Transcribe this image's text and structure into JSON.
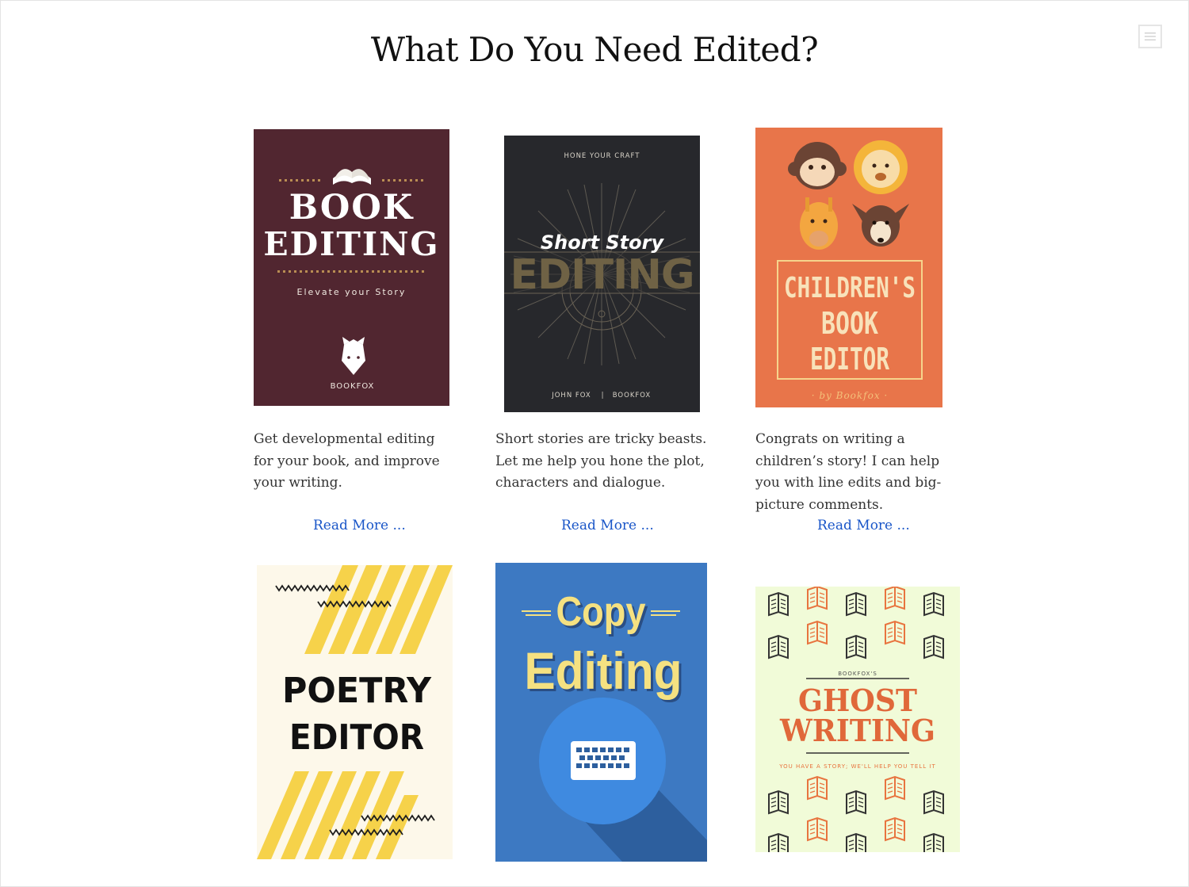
{
  "page": {
    "title": "What Do You Need Edited?"
  },
  "menu": {
    "icon": "hamburger-menu-icon"
  },
  "colors": {
    "link": "#1a56c8",
    "book_editing_bg": "#512630",
    "short_story_bg": "#27282c",
    "childrens_bg": "#e8754a",
    "poetry_bg": "#fdf8ea",
    "copy_bg": "#3d79c2",
    "ghost_bg": "#f1fbd8"
  },
  "services": [
    {
      "cover": {
        "title_line1": "BOOK",
        "title_line2": "EDITING",
        "subtitle": "Elevate your Story",
        "publisher": "BOOKFOX",
        "icons": [
          "open-book-icon",
          "fox-head-icon"
        ]
      },
      "description": "Get developmental editing for your book, and improve your writing.",
      "link": "Read More ..."
    },
    {
      "cover": {
        "top_text": "HONE YOUR CRAFT",
        "script_title": "Short Story",
        "big_title": "EDITING",
        "author": "JOHN FOX",
        "separator": "|",
        "publisher": "BOOKFOX"
      },
      "description": "Short stories are tricky beasts. Let me help you hone the plot, characters and dialogue.",
      "link": "Read More ..."
    },
    {
      "cover": {
        "line1": "CHILDREN'S",
        "line2": "BOOK",
        "line3": "EDITOR",
        "byline": "· by Bookfox ·",
        "icons": [
          "monkey-face-icon",
          "lion-face-icon",
          "giraffe-face-icon",
          "deer-face-icon"
        ]
      },
      "description": "Congrats on writing a children’s story! I can help you with line edits and big-picture comments.",
      "link": "Read More ..."
    },
    {
      "cover": {
        "line1": "POETRY",
        "line2": "EDITOR"
      }
    },
    {
      "cover": {
        "line1": "Copy",
        "line2": "Editing",
        "icon": "keyboard-icon"
      }
    },
    {
      "cover": {
        "kicker": "BOOKFOX'S",
        "line1": "GHOST",
        "line2": "WRITING",
        "tagline": "YOU HAVE A STORY; WE'LL HELP YOU TELL IT",
        "icon": "open-book-icon"
      }
    }
  ]
}
